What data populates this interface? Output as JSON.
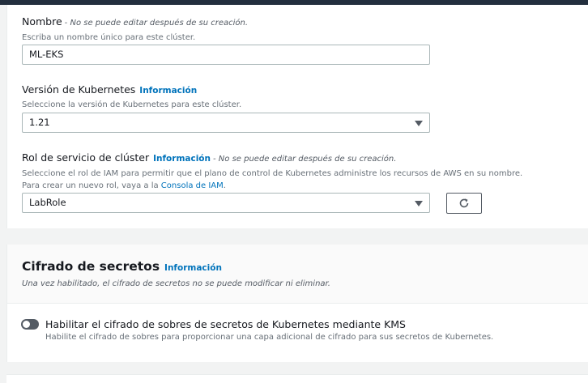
{
  "name_field": {
    "label": "Nombre",
    "note": "- No se puede editar después de su creación.",
    "description": "Escriba un nombre único para este clúster.",
    "value": "ML-EKS"
  },
  "version_field": {
    "label": "Versión de Kubernetes",
    "info": "Información",
    "description": "Seleccione la versión de Kubernetes para este clúster.",
    "value": "1.21"
  },
  "role_field": {
    "label": "Rol de servicio de clúster",
    "info": "Información",
    "note": "- No se puede editar después de su creación.",
    "description": "Seleccione el rol de IAM para permitir que el plano de control de Kubernetes administre los recursos de AWS en su nombre.",
    "create_prefix": "Para crear un nuevo rol, vaya a la ",
    "create_link": "Consola de IAM",
    "create_suffix": ".",
    "value": "LabRole"
  },
  "secrets_encryption": {
    "title": "Cifrado de secretos",
    "info": "Información",
    "description": "Una vez habilitado, el cifrado de secretos no se puede modificar ni eliminar.",
    "toggle_label": "Habilitar el cifrado de sobres de secretos de Kubernetes mediante KMS",
    "toggle_description": "Habilite el cifrado de sobres para proporcionar una capa adicional de cifrado para sus secretos de Kubernetes.",
    "toggle_on": false
  },
  "icons": {
    "caret": "caret-down-icon",
    "refresh": "refresh-icon"
  },
  "colors": {
    "link": "#0073bb",
    "header": "#232f3e",
    "toggle_off": "#545b64"
  }
}
